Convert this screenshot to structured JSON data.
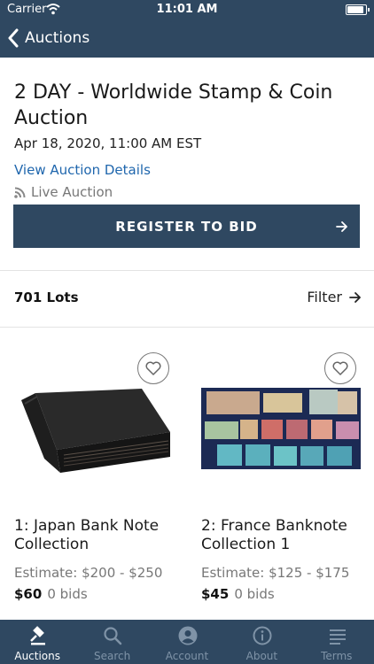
{
  "status": {
    "carrier": "Carrier",
    "time": "11:01 AM"
  },
  "nav": {
    "back_label": "Auctions"
  },
  "auction": {
    "title": "2 DAY - Worldwide Stamp & Coin Auction",
    "date": "Apr 18, 2020, 11:00 AM EST",
    "details_link": "View Auction Details",
    "live_label": "Live Auction",
    "register_label": "REGISTER TO BID"
  },
  "lots_header": {
    "count_label": "701 Lots",
    "filter_label": "Filter"
  },
  "lots": [
    {
      "title": "1: Japan Bank Note Collection",
      "estimate": "Estimate: $200 - $250",
      "price": "$60",
      "bids": "0 bids"
    },
    {
      "title": "2: France Banknote Collection 1",
      "estimate": "Estimate: $125 - $175",
      "price": "$45",
      "bids": "0 bids"
    }
  ],
  "tabs": [
    {
      "label": "Auctions",
      "icon": "gavel-icon",
      "active": true
    },
    {
      "label": "Search",
      "icon": "search-icon",
      "active": false
    },
    {
      "label": "Account",
      "icon": "account-icon",
      "active": false
    },
    {
      "label": "About",
      "icon": "info-icon",
      "active": false
    },
    {
      "label": "Terms",
      "icon": "terms-icon",
      "active": false
    }
  ],
  "colors": {
    "brand": "#2f4861",
    "link": "#1f66ad",
    "muted": "#777777"
  }
}
